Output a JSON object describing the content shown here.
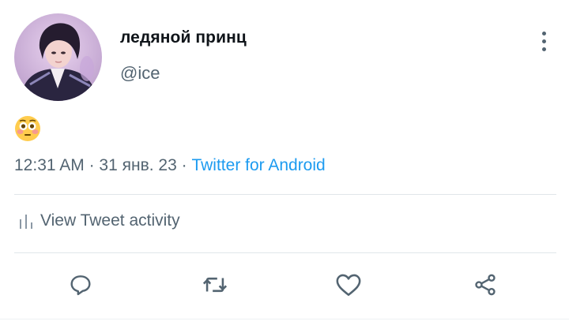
{
  "tweet": {
    "author_name": "ледяной принц",
    "author_handle": "@ice",
    "body_emoji": "flushed-face",
    "time": "12:31 AM",
    "separator": "·",
    "date": "31 янв. 23",
    "source": "Twitter for Android"
  },
  "activity": {
    "label": "View Tweet activity",
    "icon": "bar-chart-icon"
  },
  "actions": [
    {
      "name": "reply",
      "icon": "reply-icon"
    },
    {
      "name": "retweet",
      "icon": "retweet-icon"
    },
    {
      "name": "like",
      "icon": "heart-icon"
    },
    {
      "name": "share",
      "icon": "share-icon"
    }
  ],
  "colors": {
    "text_primary": "#0f1419",
    "text_secondary": "#536471",
    "link": "#1d9bf0",
    "divider": "#e1e6ea"
  }
}
